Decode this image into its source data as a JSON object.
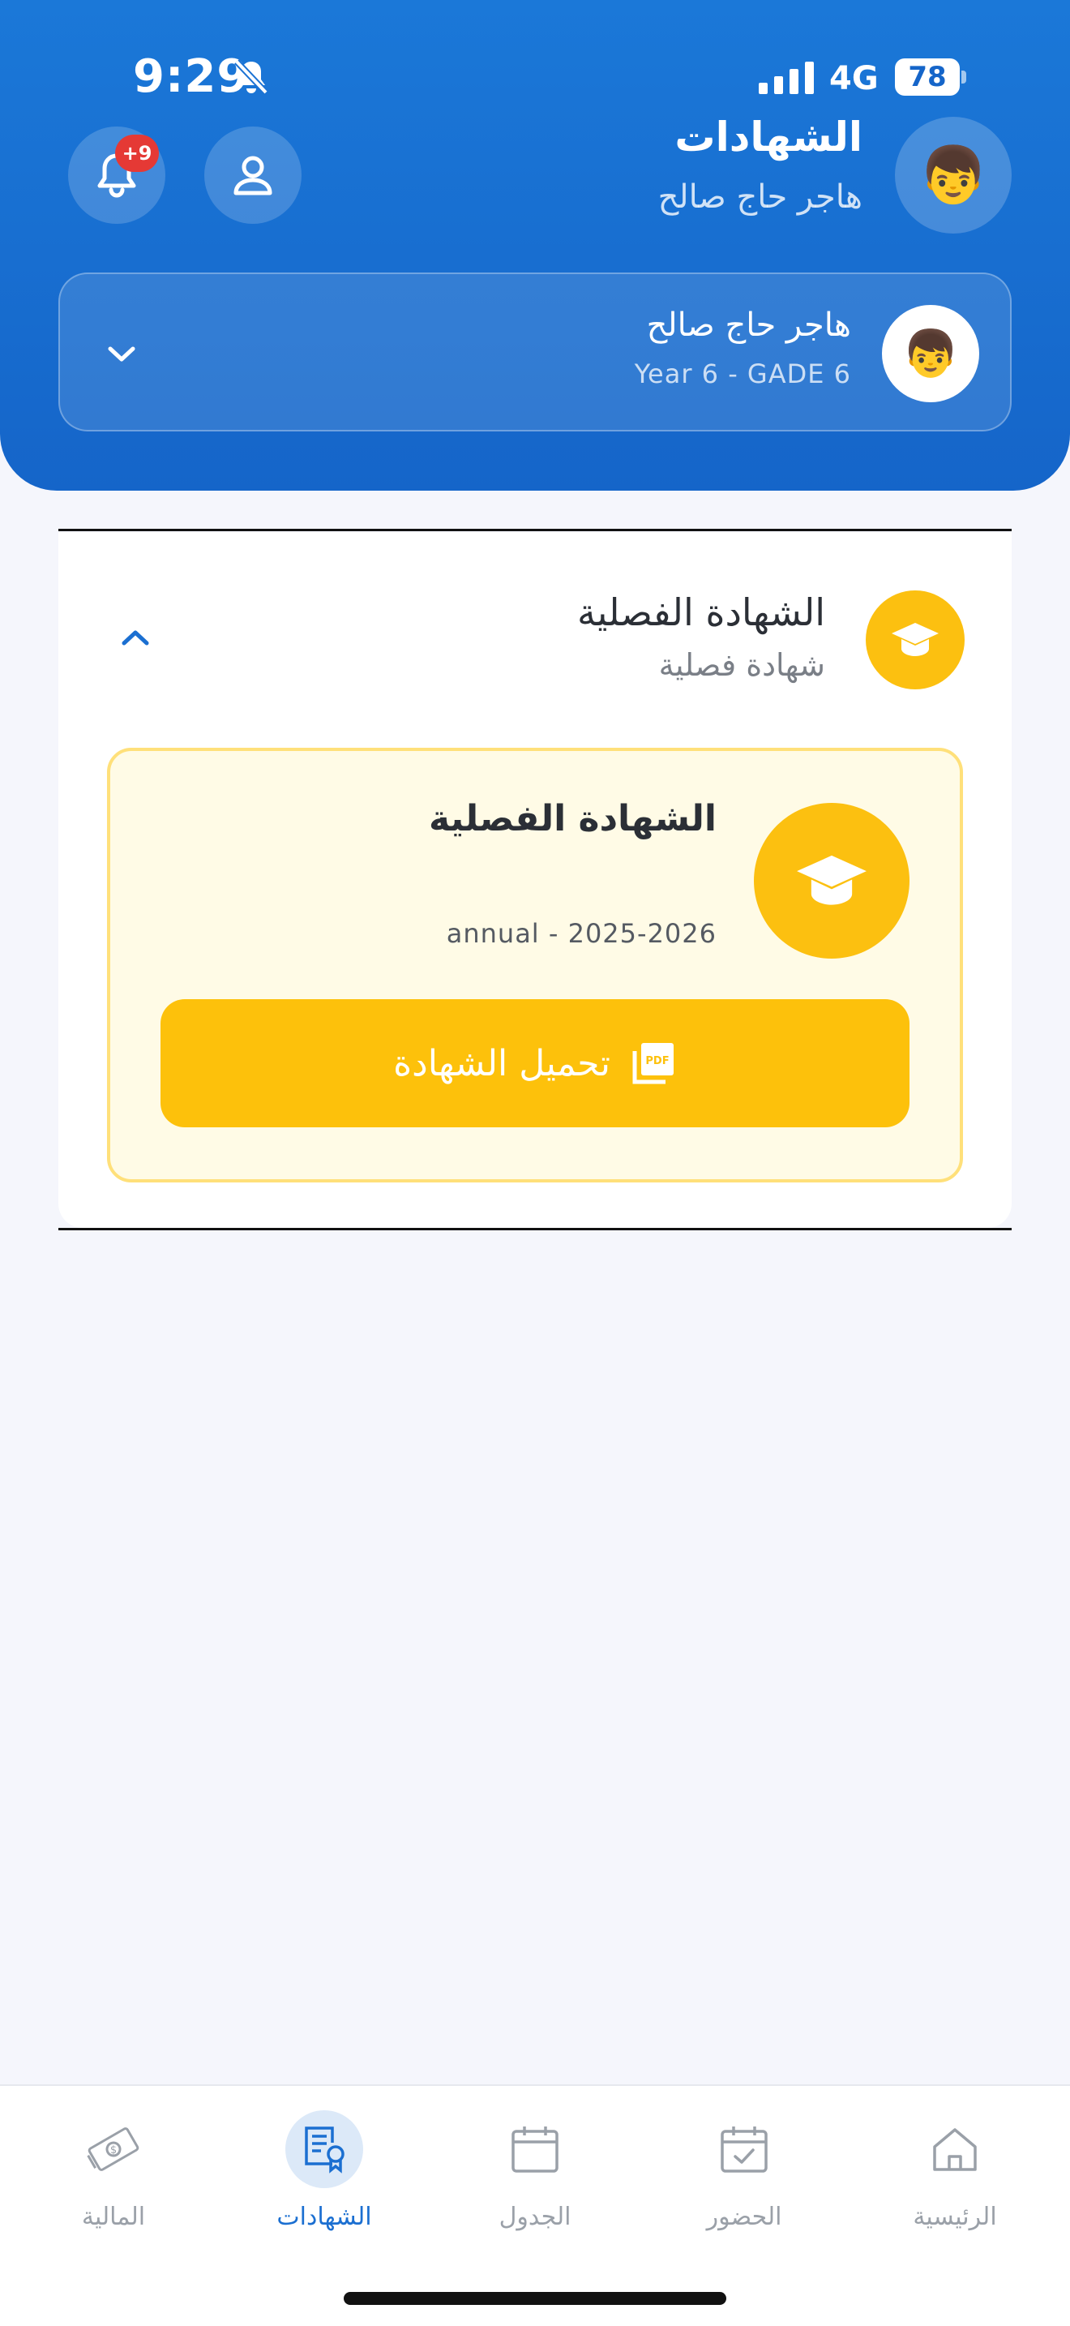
{
  "status_bar": {
    "time": "9:29",
    "network": "4G",
    "battery": "78"
  },
  "header": {
    "title": "الشهادات",
    "subtitle": "هاجر حاج صالح",
    "notification_badge": "+9",
    "avatar_emoji": "👦"
  },
  "student": {
    "name": "هاجر حاج صالح",
    "grade": "Year 6 - GADE 6",
    "avatar_emoji": "👦"
  },
  "section": {
    "title": "الشهادة الفصلية",
    "subtitle": "شهادة فصلية",
    "certificate": {
      "title": "الشهادة الفصلية",
      "period": "annual - 2025-2026",
      "download_label": "تحميل الشهادة"
    }
  },
  "nav": {
    "items": [
      {
        "label": "المالية",
        "icon": "money-icon",
        "active": false
      },
      {
        "label": "الشهادات",
        "icon": "certificate-icon",
        "active": true
      },
      {
        "label": "الجدول",
        "icon": "calendar-icon",
        "active": false
      },
      {
        "label": "الحضور",
        "icon": "calendar-check-icon",
        "active": false
      },
      {
        "label": "الرئيسية",
        "icon": "home-icon",
        "active": false
      }
    ]
  },
  "colors": {
    "primary": "#1b6fd1",
    "accent": "#fcc010",
    "badge": "#e53935"
  }
}
